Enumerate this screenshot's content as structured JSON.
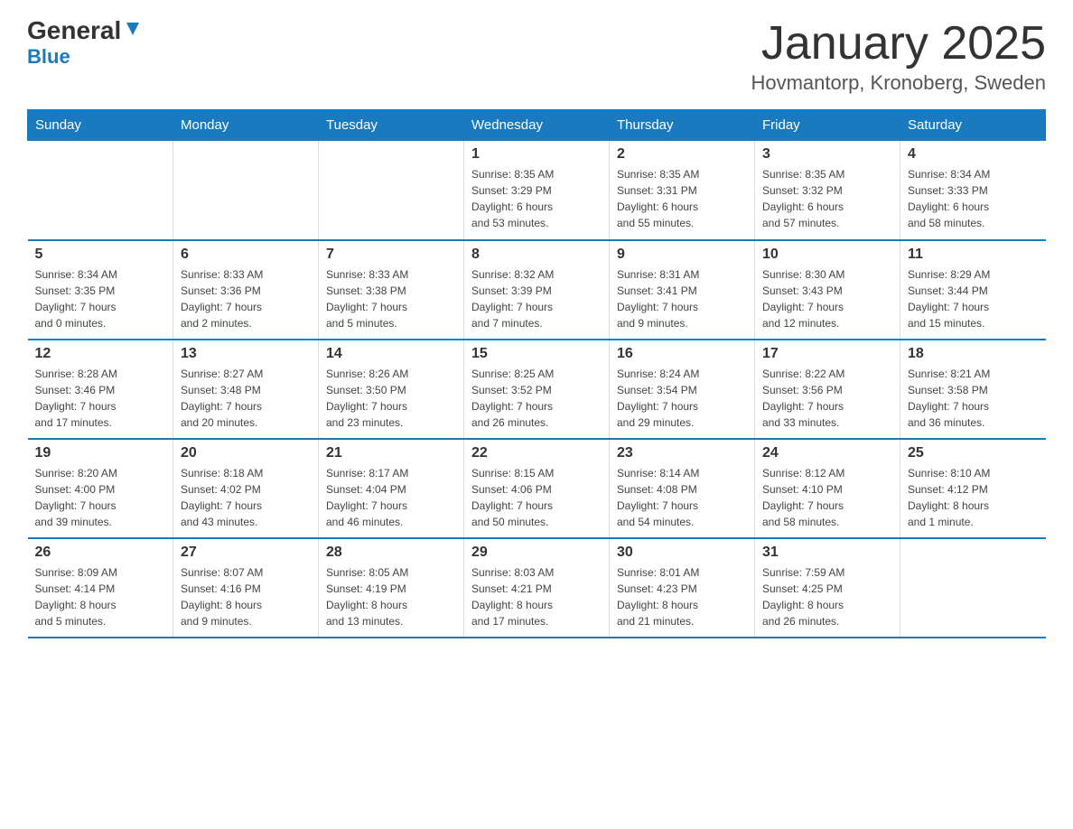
{
  "header": {
    "logo_general": "General",
    "logo_blue": "Blue",
    "month_title": "January 2025",
    "location": "Hovmantorp, Kronoberg, Sweden"
  },
  "days_of_week": [
    "Sunday",
    "Monday",
    "Tuesday",
    "Wednesday",
    "Thursday",
    "Friday",
    "Saturday"
  ],
  "weeks": [
    [
      {
        "day": "",
        "info": ""
      },
      {
        "day": "",
        "info": ""
      },
      {
        "day": "",
        "info": ""
      },
      {
        "day": "1",
        "info": "Sunrise: 8:35 AM\nSunset: 3:29 PM\nDaylight: 6 hours\nand 53 minutes."
      },
      {
        "day": "2",
        "info": "Sunrise: 8:35 AM\nSunset: 3:31 PM\nDaylight: 6 hours\nand 55 minutes."
      },
      {
        "day": "3",
        "info": "Sunrise: 8:35 AM\nSunset: 3:32 PM\nDaylight: 6 hours\nand 57 minutes."
      },
      {
        "day": "4",
        "info": "Sunrise: 8:34 AM\nSunset: 3:33 PM\nDaylight: 6 hours\nand 58 minutes."
      }
    ],
    [
      {
        "day": "5",
        "info": "Sunrise: 8:34 AM\nSunset: 3:35 PM\nDaylight: 7 hours\nand 0 minutes."
      },
      {
        "day": "6",
        "info": "Sunrise: 8:33 AM\nSunset: 3:36 PM\nDaylight: 7 hours\nand 2 minutes."
      },
      {
        "day": "7",
        "info": "Sunrise: 8:33 AM\nSunset: 3:38 PM\nDaylight: 7 hours\nand 5 minutes."
      },
      {
        "day": "8",
        "info": "Sunrise: 8:32 AM\nSunset: 3:39 PM\nDaylight: 7 hours\nand 7 minutes."
      },
      {
        "day": "9",
        "info": "Sunrise: 8:31 AM\nSunset: 3:41 PM\nDaylight: 7 hours\nand 9 minutes."
      },
      {
        "day": "10",
        "info": "Sunrise: 8:30 AM\nSunset: 3:43 PM\nDaylight: 7 hours\nand 12 minutes."
      },
      {
        "day": "11",
        "info": "Sunrise: 8:29 AM\nSunset: 3:44 PM\nDaylight: 7 hours\nand 15 minutes."
      }
    ],
    [
      {
        "day": "12",
        "info": "Sunrise: 8:28 AM\nSunset: 3:46 PM\nDaylight: 7 hours\nand 17 minutes."
      },
      {
        "day": "13",
        "info": "Sunrise: 8:27 AM\nSunset: 3:48 PM\nDaylight: 7 hours\nand 20 minutes."
      },
      {
        "day": "14",
        "info": "Sunrise: 8:26 AM\nSunset: 3:50 PM\nDaylight: 7 hours\nand 23 minutes."
      },
      {
        "day": "15",
        "info": "Sunrise: 8:25 AM\nSunset: 3:52 PM\nDaylight: 7 hours\nand 26 minutes."
      },
      {
        "day": "16",
        "info": "Sunrise: 8:24 AM\nSunset: 3:54 PM\nDaylight: 7 hours\nand 29 minutes."
      },
      {
        "day": "17",
        "info": "Sunrise: 8:22 AM\nSunset: 3:56 PM\nDaylight: 7 hours\nand 33 minutes."
      },
      {
        "day": "18",
        "info": "Sunrise: 8:21 AM\nSunset: 3:58 PM\nDaylight: 7 hours\nand 36 minutes."
      }
    ],
    [
      {
        "day": "19",
        "info": "Sunrise: 8:20 AM\nSunset: 4:00 PM\nDaylight: 7 hours\nand 39 minutes."
      },
      {
        "day": "20",
        "info": "Sunrise: 8:18 AM\nSunset: 4:02 PM\nDaylight: 7 hours\nand 43 minutes."
      },
      {
        "day": "21",
        "info": "Sunrise: 8:17 AM\nSunset: 4:04 PM\nDaylight: 7 hours\nand 46 minutes."
      },
      {
        "day": "22",
        "info": "Sunrise: 8:15 AM\nSunset: 4:06 PM\nDaylight: 7 hours\nand 50 minutes."
      },
      {
        "day": "23",
        "info": "Sunrise: 8:14 AM\nSunset: 4:08 PM\nDaylight: 7 hours\nand 54 minutes."
      },
      {
        "day": "24",
        "info": "Sunrise: 8:12 AM\nSunset: 4:10 PM\nDaylight: 7 hours\nand 58 minutes."
      },
      {
        "day": "25",
        "info": "Sunrise: 8:10 AM\nSunset: 4:12 PM\nDaylight: 8 hours\nand 1 minute."
      }
    ],
    [
      {
        "day": "26",
        "info": "Sunrise: 8:09 AM\nSunset: 4:14 PM\nDaylight: 8 hours\nand 5 minutes."
      },
      {
        "day": "27",
        "info": "Sunrise: 8:07 AM\nSunset: 4:16 PM\nDaylight: 8 hours\nand 9 minutes."
      },
      {
        "day": "28",
        "info": "Sunrise: 8:05 AM\nSunset: 4:19 PM\nDaylight: 8 hours\nand 13 minutes."
      },
      {
        "day": "29",
        "info": "Sunrise: 8:03 AM\nSunset: 4:21 PM\nDaylight: 8 hours\nand 17 minutes."
      },
      {
        "day": "30",
        "info": "Sunrise: 8:01 AM\nSunset: 4:23 PM\nDaylight: 8 hours\nand 21 minutes."
      },
      {
        "day": "31",
        "info": "Sunrise: 7:59 AM\nSunset: 4:25 PM\nDaylight: 8 hours\nand 26 minutes."
      },
      {
        "day": "",
        "info": ""
      }
    ]
  ]
}
